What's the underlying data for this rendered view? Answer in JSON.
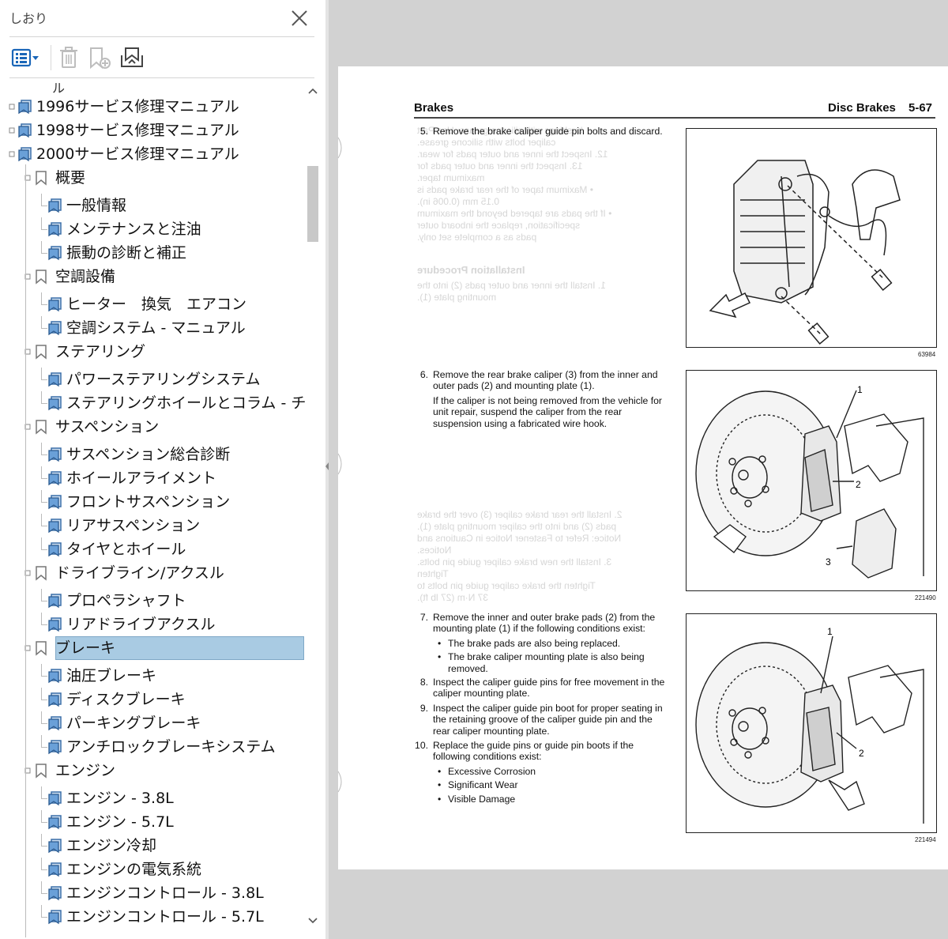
{
  "panel": {
    "title": "しおり",
    "toolbar": {
      "options": "options-icon",
      "delete": "delete-icon",
      "new_bookmark": "new-bookmark-icon",
      "expand": "expand-bookmark-icon"
    }
  },
  "bookmarks": [
    {
      "label": "1996サービス修理マニュアル",
      "level": 0
    },
    {
      "label": "1998サービス修理マニュアル",
      "level": 0
    },
    {
      "label": "2000サービス修理マニュアル",
      "level": 0
    },
    {
      "label": "概要",
      "level": 1
    },
    {
      "label": "一般情報",
      "level": 2
    },
    {
      "label": "メンテナンスと注油",
      "level": 2
    },
    {
      "label": "振動の診断と補正",
      "level": 2
    },
    {
      "label": "空調設備",
      "level": 1
    },
    {
      "label": "ヒーター　換気　エアコン",
      "level": 2
    },
    {
      "label": "空調システム - マニュアル",
      "level": 2
    },
    {
      "label": "ステアリング",
      "level": 1
    },
    {
      "label": "パワーステアリングシステム",
      "level": 2
    },
    {
      "label": "ステアリングホイールとコラム - チルト",
      "level": 2
    },
    {
      "label": "サスペンション",
      "level": 1
    },
    {
      "label": "サスペンション総合診断",
      "level": 2
    },
    {
      "label": "ホイールアライメント",
      "level": 2
    },
    {
      "label": "フロントサスペンション",
      "level": 2
    },
    {
      "label": "リアサスペンション",
      "level": 2
    },
    {
      "label": "タイヤとホイール",
      "level": 2
    },
    {
      "label": "ドライブライン/アクスル",
      "level": 1
    },
    {
      "label": "プロペラシャフト",
      "level": 2
    },
    {
      "label": "リアドライブアクスル",
      "level": 2
    },
    {
      "label": "ブレーキ",
      "level": 1,
      "selected": true
    },
    {
      "label": "油圧ブレーキ",
      "level": 2
    },
    {
      "label": "ディスクブレーキ",
      "level": 2
    },
    {
      "label": "パーキングブレーキ",
      "level": 2
    },
    {
      "label": "アンチロックブレーキシステム",
      "level": 2
    },
    {
      "label": "エンジン",
      "level": 1
    },
    {
      "label": "エンジン - 3.8L",
      "level": 2
    },
    {
      "label": "エンジン - 5.7L",
      "level": 2
    },
    {
      "label": "エンジン冷却",
      "level": 2
    },
    {
      "label": "エンジンの電気系統",
      "level": 2
    },
    {
      "label": "エンジンコントロール - 3.8L",
      "level": 2
    },
    {
      "label": "エンジンコントロール - 5.7L",
      "level": 2
    }
  ],
  "doc": {
    "header_left": "Brakes",
    "header_right": "Disc Brakes",
    "page_number": "5-67",
    "step5": {
      "num": "5.",
      "text": "Remove the brake caliper guide pin bolts and discard."
    },
    "step6": {
      "num": "6.",
      "text": "Remove the rear brake caliper (3) from the inner and outer pads (2) and mounting plate (1).",
      "note": "If the caliper is not being removed from the vehicle for unit repair, suspend the caliper from the rear suspension using a fabricated wire hook."
    },
    "step7": {
      "num": "7.",
      "text": "Remove the inner and outer brake pads (2) from the mounting plate (1) if the following conditions exist:",
      "bullets": [
        "The brake pads are also being replaced.",
        "The brake caliper mounting plate is also being removed."
      ]
    },
    "step8": {
      "num": "8.",
      "text": "Inspect the caliper guide pins for free movement in the caliper mounting plate."
    },
    "step9": {
      "num": "9.",
      "text": "Inspect the caliper guide pin boot for proper seating in the retaining groove of the caliper guide pin and the rear caliper mounting plate."
    },
    "step10": {
      "num": "10.",
      "text": "Replace the guide pins or guide pin boots if the following conditions exist:",
      "bullets": [
        "Excessive Corrosion",
        "Significant Wear",
        "Visible Damage"
      ]
    },
    "figures": [
      {
        "number": "63984"
      },
      {
        "number": "221490",
        "callouts": [
          "1",
          "2",
          "3"
        ]
      },
      {
        "number": "221494",
        "callouts": [
          "1",
          "2"
        ]
      }
    ],
    "bleed": {
      "top": "bushings with silicone grease. Use Part\ncaliper bolts with silicone grease.\n12. Inspect the inner and outer pads for wear.\n13. Inspect the inner and outer pads for\nmaximum taper.\n• Maximum taper of the rear brake pads is\n0.15 mm (0.006 in).\n• If the pads are tapered beyond the maximum\nspecification, replace the inboard outer\npads as a complete set only.",
      "heading": "Installation Procedure",
      "after": "1. Install the inner and outer pads (2) into the\nmounting plate (1).",
      "mid": "2. Install the rear brake caliper (3) over the brake\npads (2) and into the caliper mounting plate (1).\nNotice: Refer to Fastener Notice in Cautions and\nNotices.\n3. Install the new brake caliper guide pin bolts.\nTighten\nTighten the brake caliper guide pin bolts to\n37 N·m (27 lb ft)."
    }
  }
}
